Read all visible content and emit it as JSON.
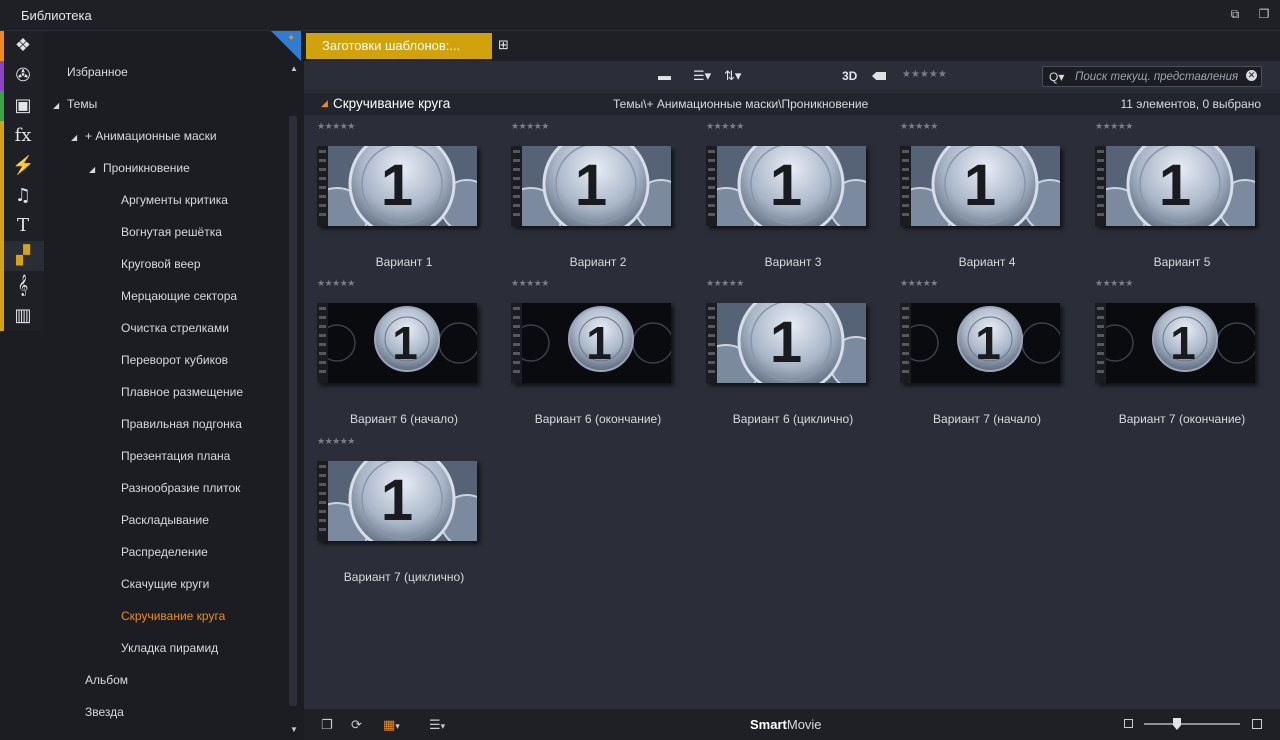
{
  "window": {
    "title": "Библиотека"
  },
  "categories": [
    {
      "icon": "layers-icon",
      "color": "#f08a1c",
      "glyph": "❖"
    },
    {
      "icon": "film-reel-icon",
      "color": "#8b44c4",
      "glyph": "✇"
    },
    {
      "icon": "stacked-frames-icon",
      "color": "#3aa34a",
      "glyph": "▣"
    },
    {
      "icon": "fx-icon",
      "color": "#d4a414",
      "glyph": "fx"
    },
    {
      "icon": "lightning-icon",
      "color": "#d4a414",
      "glyph": "⚡"
    },
    {
      "icon": "music-note-icon",
      "color": "#d4a414",
      "glyph": "♫"
    },
    {
      "icon": "text-icon",
      "color": "#d4a414",
      "glyph": "T"
    },
    {
      "icon": "montage-icon",
      "color": "#d4a414",
      "glyph": "▞"
    },
    {
      "icon": "treble-clef-icon",
      "color": "#d4a414",
      "glyph": "𝄞"
    },
    {
      "icon": "piano-icon",
      "color": "#d4a414",
      "glyph": "▥"
    }
  ],
  "tree": {
    "items": [
      {
        "label": "Избранное",
        "level": 0,
        "arrow": "",
        "selected": false
      },
      {
        "label": "Темы",
        "level": 0,
        "arrow": "◢",
        "selected": false
      },
      {
        "label": "+ Анимационные маски",
        "level": 1,
        "arrow": "◢",
        "selected": false
      },
      {
        "label": "Проникновение",
        "level": 2,
        "arrow": "◢",
        "selected": false
      },
      {
        "label": "Аргументы критика",
        "level": 3,
        "arrow": "",
        "selected": false
      },
      {
        "label": "Вогнутая решётка",
        "level": 3,
        "arrow": "",
        "selected": false
      },
      {
        "label": "Круговой веер",
        "level": 3,
        "arrow": "",
        "selected": false
      },
      {
        "label": "Мерцающие сектора",
        "level": 3,
        "arrow": "",
        "selected": false
      },
      {
        "label": "Очистка стрелками",
        "level": 3,
        "arrow": "",
        "selected": false
      },
      {
        "label": "Переворот кубиков",
        "level": 3,
        "arrow": "",
        "selected": false
      },
      {
        "label": "Плавное размещение",
        "level": 3,
        "arrow": "",
        "selected": false
      },
      {
        "label": "Правильная подгонка",
        "level": 3,
        "arrow": "",
        "selected": false
      },
      {
        "label": "Презентация плана",
        "level": 3,
        "arrow": "",
        "selected": false
      },
      {
        "label": "Разнообразие плиток",
        "level": 3,
        "arrow": "",
        "selected": false
      },
      {
        "label": "Раскладывание",
        "level": 3,
        "arrow": "",
        "selected": false
      },
      {
        "label": "Распределение",
        "level": 3,
        "arrow": "",
        "selected": false
      },
      {
        "label": "Скачущие круги",
        "level": 3,
        "arrow": "",
        "selected": false
      },
      {
        "label": "Скручивание круга",
        "level": 3,
        "arrow": "",
        "selected": true
      },
      {
        "label": "Укладка пирамид",
        "level": 3,
        "arrow": "",
        "selected": false
      },
      {
        "label": "Альбом",
        "level": 1,
        "arrow": "",
        "selected": false
      },
      {
        "label": "Звезда",
        "level": 1,
        "arrow": "",
        "selected": false
      }
    ]
  },
  "tabs": {
    "active_label": "Заготовки шаблонов:..."
  },
  "toolbar": {
    "btn_3d": "3D",
    "rating": "★★★★★",
    "search_placeholder": "Поиск текущ. представления",
    "search_value": ""
  },
  "pathbar": {
    "name": "Скручивание круга",
    "path": "Темы\\+ Анимационные маски\\Проникновение",
    "count": "11 элементов, 0 выбрано"
  },
  "items": [
    {
      "label": "Вариант 1",
      "rating": "★★★★★",
      "style": "full"
    },
    {
      "label": "Вариант 2",
      "rating": "★★★★★",
      "style": "full"
    },
    {
      "label": "Вариант 3",
      "rating": "★★★★★",
      "style": "full"
    },
    {
      "label": "Вариант 4",
      "rating": "★★★★★",
      "style": "full"
    },
    {
      "label": "Вариант 5",
      "rating": "★★★★★",
      "style": "full"
    },
    {
      "label": "Вариант 6 (начало)",
      "rating": "★★★★★",
      "style": "small"
    },
    {
      "label": "Вариант 6 (окончание)",
      "rating": "★★★★★",
      "style": "small"
    },
    {
      "label": "Вариант 6 (циклично)",
      "rating": "★★★★★",
      "style": "full"
    },
    {
      "label": "Вариант 7 (начало)",
      "rating": "★★★★★",
      "style": "small"
    },
    {
      "label": "Вариант 7 (окончание)",
      "rating": "★★★★★",
      "style": "small"
    },
    {
      "label": "Вариант 7 (циклично)",
      "rating": "★★★★★",
      "style": "full"
    }
  ],
  "thumb_number": "1",
  "bottombar": {
    "brand_bold": "Smart",
    "brand_rest": "Movie"
  },
  "colors": {
    "accent": "#f08a1c",
    "tab": "#d0a20c",
    "pin": "#2f7dd1"
  }
}
